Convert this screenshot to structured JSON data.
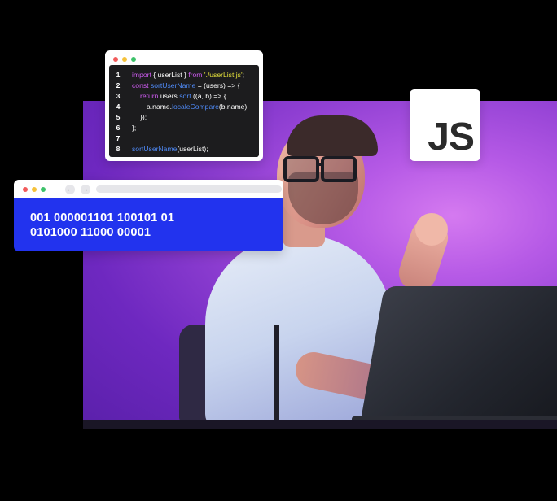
{
  "code_window": {
    "dots": [
      "#f25b5b",
      "#f5c23b",
      "#3dc26a"
    ],
    "lines": [
      {
        "num": "1",
        "tokens": [
          {
            "t": "import",
            "c": "kw"
          },
          {
            "t": " { userList } ",
            "c": "plain"
          },
          {
            "t": "from",
            "c": "kw"
          },
          {
            "t": " ",
            "c": "plain"
          },
          {
            "t": "'./userList.js'",
            "c": "str"
          },
          {
            "t": ";",
            "c": "plain"
          }
        ]
      },
      {
        "num": "2",
        "tokens": [
          {
            "t": "const",
            "c": "kw"
          },
          {
            "t": " ",
            "c": "plain"
          },
          {
            "t": "sortUserName",
            "c": "fn"
          },
          {
            "t": " = (users) => {",
            "c": "plain"
          }
        ]
      },
      {
        "num": "3",
        "indent": "ind1",
        "tokens": [
          {
            "t": "return",
            "c": "kw"
          },
          {
            "t": " users.",
            "c": "plain"
          },
          {
            "t": "sort",
            "c": "fn"
          },
          {
            "t": " ((a, b) => {",
            "c": "plain"
          }
        ]
      },
      {
        "num": "4",
        "indent": "ind2",
        "tokens": [
          {
            "t": "a.name.",
            "c": "plain"
          },
          {
            "t": "localeCompare",
            "c": "fn"
          },
          {
            "t": "(b.name);",
            "c": "plain"
          }
        ]
      },
      {
        "num": "5",
        "indent": "ind3",
        "tokens": [
          {
            "t": "});",
            "c": "plain"
          }
        ]
      },
      {
        "num": "6",
        "tokens": [
          {
            "t": "};",
            "c": "plain"
          }
        ]
      },
      {
        "num": "7",
        "tokens": []
      },
      {
        "num": "8",
        "tokens": [
          {
            "t": "sortUserName",
            "c": "fn"
          },
          {
            "t": "(userList);",
            "c": "plain"
          }
        ]
      }
    ]
  },
  "js_badge": {
    "label": "JS"
  },
  "binary_window": {
    "dots": [
      "#f25b5b",
      "#f5c23b",
      "#3dc26a"
    ],
    "back_icon": "←",
    "forward_icon": "→",
    "line1": "001 000001101 100101 01",
    "line2": "0101000 11000 00001"
  },
  "colors": {
    "keyword": "#d05cf3",
    "function": "#4f8af7",
    "string": "#e6e33b",
    "binary_bg": "#2233ee"
  }
}
